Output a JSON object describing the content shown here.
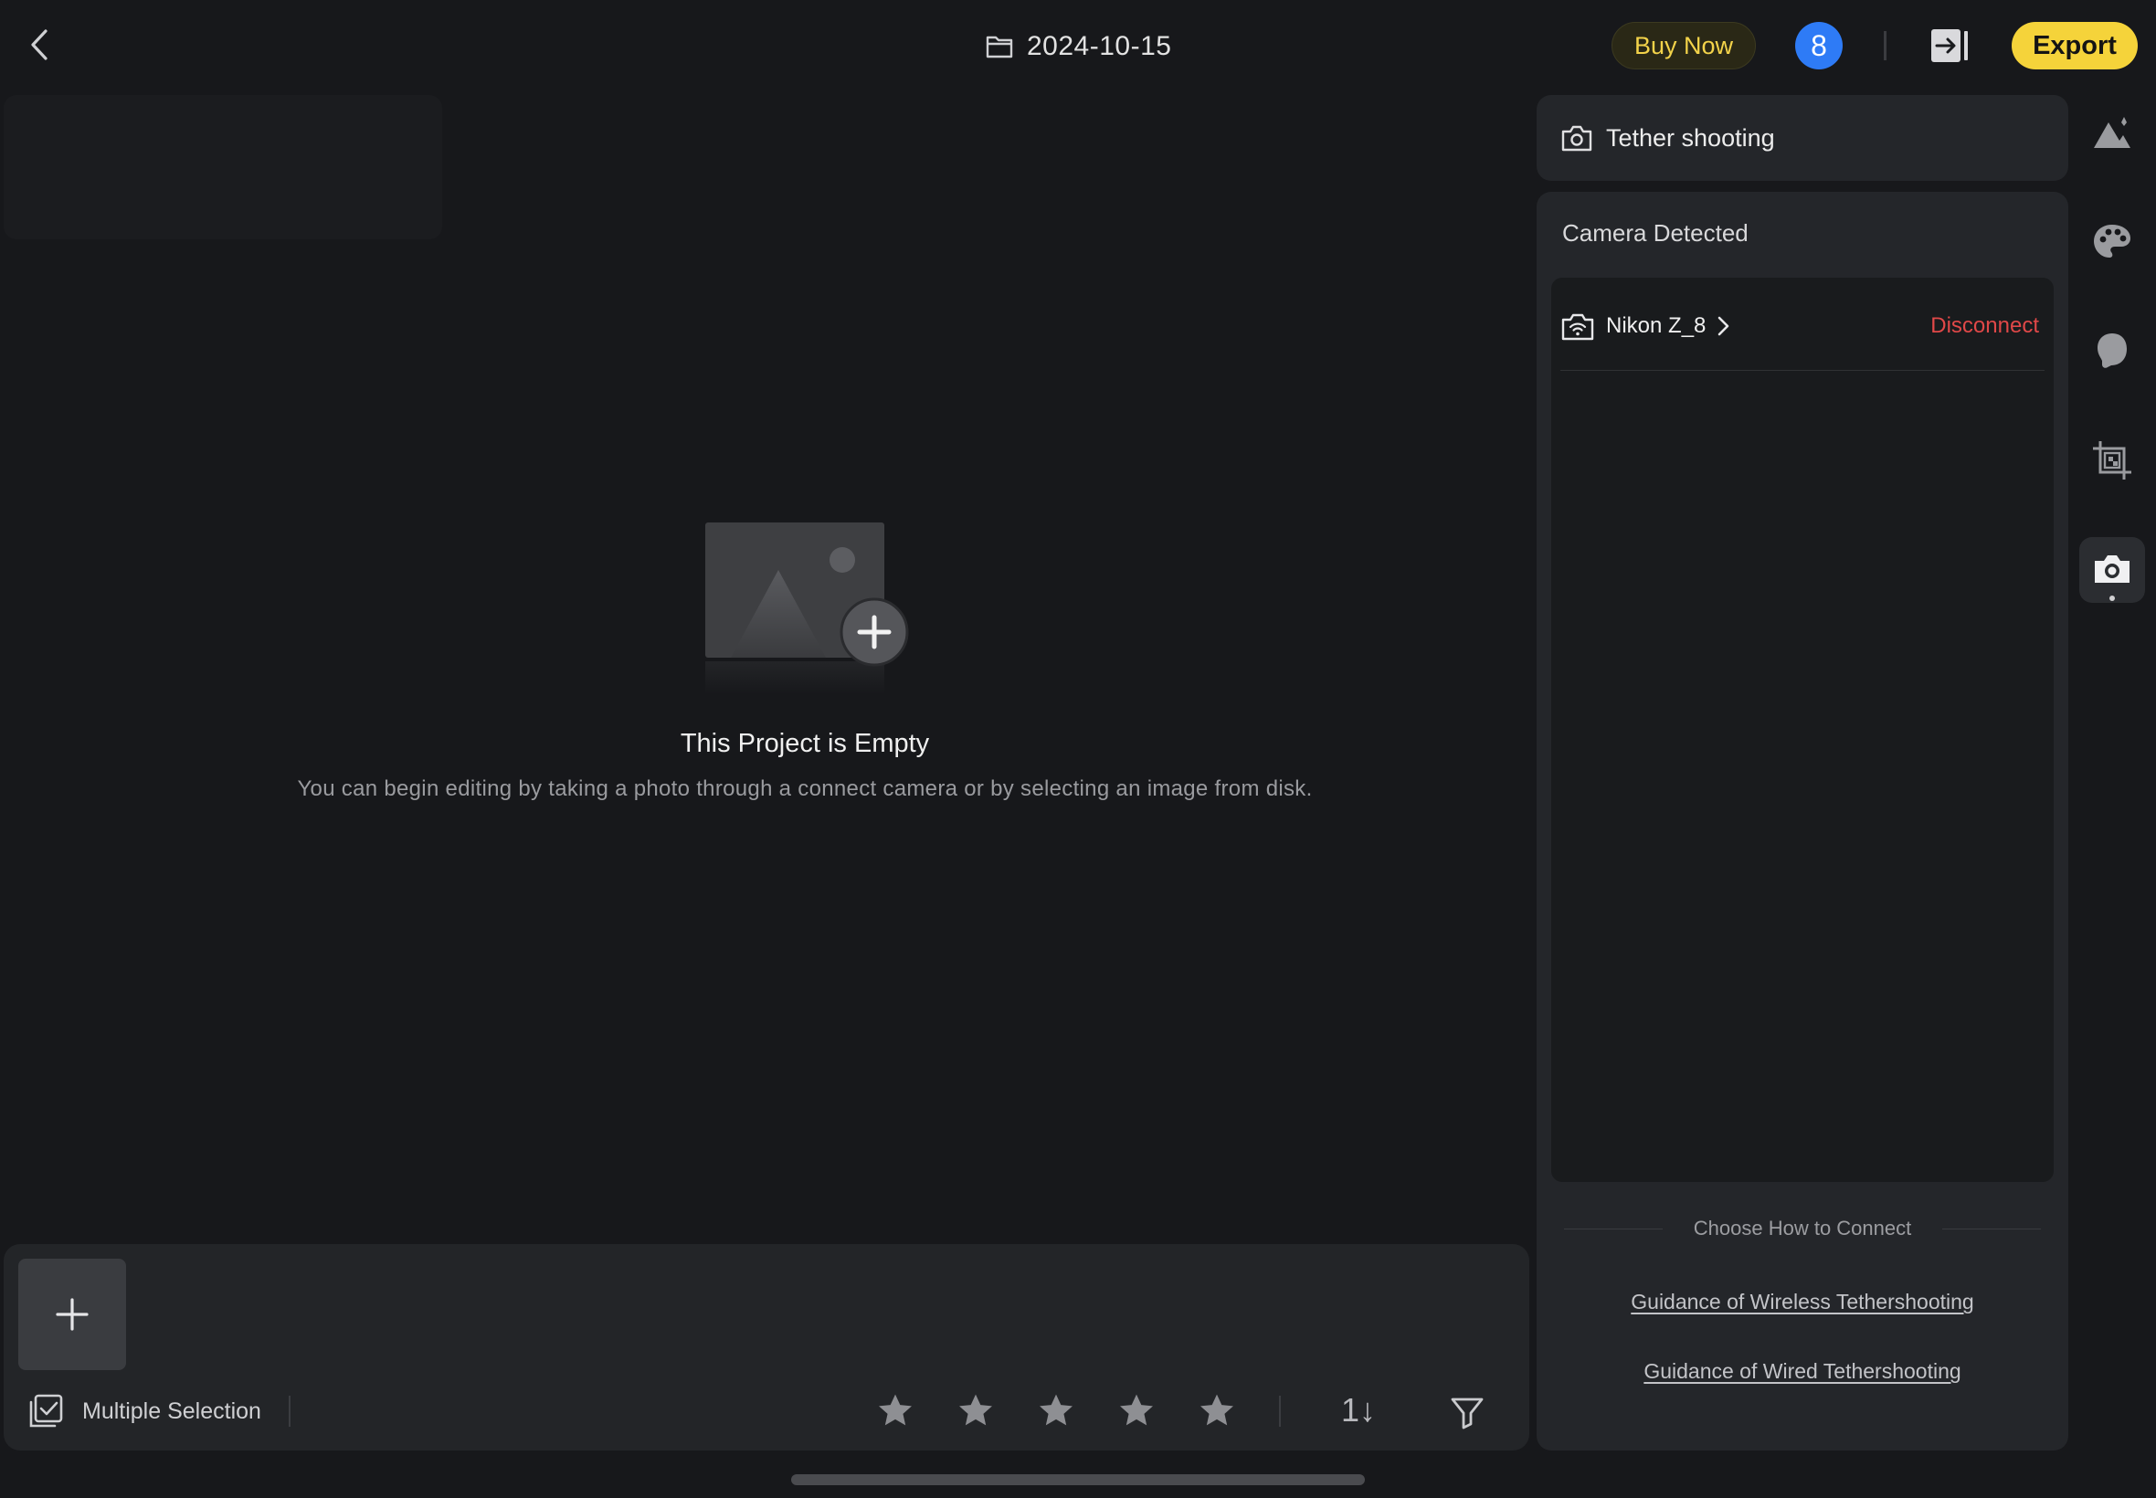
{
  "header": {
    "project_title": "2024-10-15",
    "buy_label": "Buy Now",
    "badge_count": "8",
    "export_label": "Export"
  },
  "empty_state": {
    "title": "This Project is Empty",
    "description": "You can begin editing by taking a photo through a connect camera or by selecting an image from disk."
  },
  "bottom_bar": {
    "multi_select_label": "Multiple Selection",
    "sort_label": "1↓",
    "rating_stars": 5
  },
  "tether_panel": {
    "title": "Tether shooting",
    "status": "Camera Detected",
    "camera_name": "Nikon Z_8",
    "disconnect_label": "Disconnect",
    "choose_label": "Choose How to Connect",
    "wireless_link": "Guidance of Wireless Tethershooting",
    "wired_link": "Guidance of Wired Tethershooting"
  },
  "side_tools": [
    {
      "name": "landscape-tool-icon"
    },
    {
      "name": "palette-icon"
    },
    {
      "name": "portrait-icon"
    },
    {
      "name": "crop-icon"
    },
    {
      "name": "camera-tool-icon",
      "active": true
    }
  ],
  "colors": {
    "accent_yellow": "#f5d33a",
    "badge_blue": "#2e7bf6",
    "danger_red": "#e04848"
  }
}
